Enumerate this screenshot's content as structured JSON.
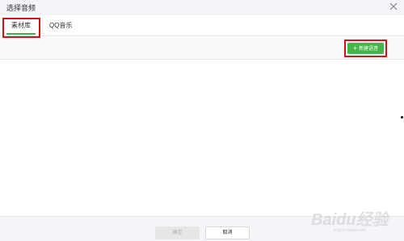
{
  "dialog": {
    "title": "选择音频"
  },
  "tabs": [
    {
      "label": "素材库",
      "active": true
    },
    {
      "label": "QQ音乐",
      "active": false
    }
  ],
  "toolbar": {
    "new_label": "新建语音"
  },
  "footer": {
    "confirm_label": "确定",
    "cancel_label": "取消"
  },
  "watermark": {
    "text": "Baidu经验",
    "sub": "jingyan.baidu.com"
  },
  "colors": {
    "accent": "#44b549",
    "highlight": "#d0121b"
  },
  "icons": {
    "close": "close-icon",
    "add": "plus-icon"
  }
}
